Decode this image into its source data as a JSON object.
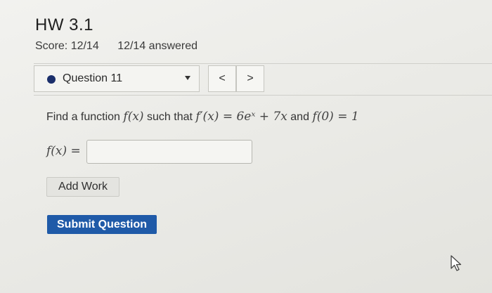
{
  "header": {
    "title": "HW 3.1",
    "score": "Score: 12/14",
    "answered": "12/14 answered"
  },
  "question_nav": {
    "selected_question": "Question 11",
    "prev_label": "<",
    "next_label": ">"
  },
  "question": {
    "prefix": "Find a function",
    "fx": "f(x)",
    "such_that": "such that",
    "derivative_eq": "f′(x) = 6eˣ + 7x",
    "and": "and",
    "initial_condition": "f(0) = 1"
  },
  "answer": {
    "label": "f(x) =",
    "value": ""
  },
  "buttons": {
    "add_work": "Add Work",
    "submit": "Submit Question"
  },
  "colors": {
    "submit_bg": "#1f5aa8",
    "status_dot": "#1b2f6b"
  }
}
